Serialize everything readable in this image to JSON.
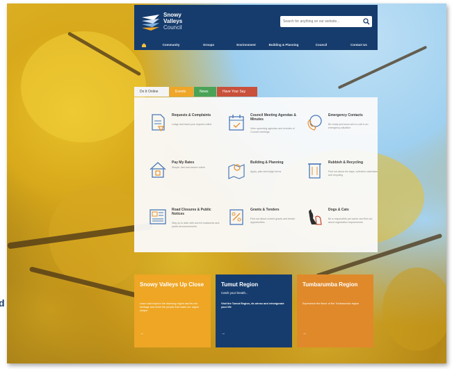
{
  "colors": {
    "header_bg": "#163c6d",
    "tab_active": "#f4f4f4",
    "tab_orange": "#f0a628",
    "tab_green": "#4aa357",
    "tab_red": "#c9503a",
    "card_yellow": "#eea624",
    "card_navy": "#163c6d",
    "card_orange": "#e0892a",
    "icon_blue": "#4a78b8",
    "icon_orange": "#e8902f"
  },
  "header": {
    "logo_line1": "Snowy",
    "logo_line2": "Valleys",
    "logo_line3": "Council",
    "search_placeholder": "Search for anything on our website..."
  },
  "nav": {
    "home_icon": "home-icon",
    "items": [
      "Community",
      "Groups",
      "Environment",
      "Building & Planning",
      "Council",
      "Contact Us"
    ]
  },
  "tabs": [
    "Do It Online",
    "Events",
    "News",
    "Have Your Say"
  ],
  "services": [
    {
      "title": "Requests & Complaints",
      "desc": "Lodge and track your request online",
      "icon": "document-icon"
    },
    {
      "title": "Council Meeting Agendas & Minutes",
      "desc": "View upcoming agendas and minutes of Council meetings",
      "icon": "calendar-icon"
    },
    {
      "title": "Emergency Contacts",
      "desc": "Be ready and know who to call in an emergency situation",
      "icon": "phone-icon"
    },
    {
      "title": "Pay My Rates",
      "desc": "Simple, fast and secure online",
      "icon": "house-icon"
    },
    {
      "title": "Building & Planning",
      "desc": "Apply, plan and lodge forms",
      "icon": "map-pin-icon"
    },
    {
      "title": "Rubbish & Recycling",
      "desc": "Find out about bin days, collection calendars and recycling",
      "icon": "bin-icon"
    },
    {
      "title": "Road Closures & Public Notices",
      "desc": "Stay up to date with current roadworks and public announcements",
      "icon": "notice-board-icon"
    },
    {
      "title": "Grants & Tenders",
      "desc": "Find out about current grants and tender opportunities",
      "icon": "grants-form-icon"
    },
    {
      "title": "Dogs & Cats",
      "desc": "Be a responsible pet owner and find out about registration requirements",
      "icon": "pets-icon"
    }
  ],
  "cards": [
    {
      "title": "Snowy Valleys Up Close",
      "body": "Learn and explore the stunning region and its rich heritage and meet the people that make our region unique",
      "more": "→"
    },
    {
      "title": "Tumut Region",
      "subtitle": "Catch your breath...",
      "body": "Visit the Tumut Region, de-stress and reinvigorate your life",
      "more": "→"
    },
    {
      "title": "Tumbarumba Region",
      "body": "Experience the flavor of the Tumbarumba region",
      "more": "→"
    }
  ],
  "edge_letter": "d"
}
